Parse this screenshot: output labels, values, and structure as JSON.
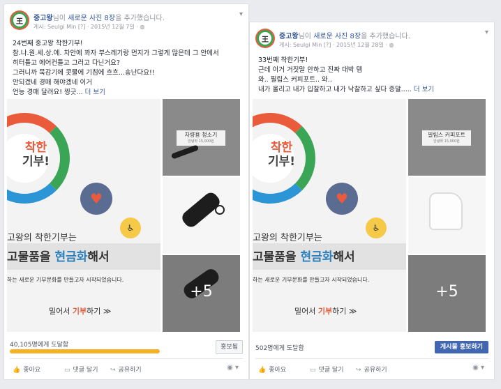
{
  "posts": [
    {
      "author": "중고왕",
      "action_pre": "님이 ",
      "action_link": "새로운 사진 8장",
      "action_post": "을 추가했습니다.",
      "meta": "게시: Seulgi Min [?] · 2015년 12월 7일 · ",
      "body_lines": [
        "24번째 중고왕 착한기부!",
        "참.나.원.세.상.에. 차안에 꽈자 부스레기랑 먼지가 그렇게 많은데 그 안에서",
        "히터틀고 에어컨틀고 그러고 다닌거요?",
        "그러니까 묵감기에 콧물에 기침에 흐흐...숑난다요!!",
        "안되겠네 경매 해야겠네 이거",
        "언능 경매 달려요! 찡긋...  "
      ],
      "more_label": "더 보기",
      "thumb_label": "차량용 청소기",
      "thumb_small": "안녕하 15,000원",
      "plus_count": "+5",
      "reach": "40,105명에게 도달함",
      "reach_fraction": 0.62,
      "promote_label": "홍보됨",
      "actions": {
        "like": "좋아요",
        "comment": "댓글 달기",
        "share": "공유하기"
      }
    },
    {
      "author": "중고왕",
      "action_pre": "님이 ",
      "action_link": "새로운 사진 8장",
      "action_post": "을 추가했습니다.",
      "meta": "게시: Seulgi Min [?] · 2015년 12월 28일 · ",
      "body_lines": [
        "33번째 착한기부!",
        "근데 이거 거짓말 안하고 진짜 대박 템",
        "와.. 필립스 커피포트.. 와..",
        "내가 올리고 내가 입찰하고 내가 낙찰하고 싶다 증말.....  "
      ],
      "more_label": "더 보기",
      "thumb_label": "필립스 커피포트",
      "thumb_small": "안녕하 15,000원",
      "plus_count": "+5",
      "reach": "502명에게 도달함",
      "promote_label": "게시물 홍보하기",
      "actions": {
        "like": "좋아요",
        "comment": "댓글 달기",
        "share": "공유하기"
      }
    }
  ],
  "poster": {
    "logo_line1": "착한",
    "logo_line2": "기부!",
    "caption1": "고왕의 착한기부는",
    "caption2_pre": "고물품을 ",
    "caption2_bold": "현금화",
    "caption2_post": "해서",
    "caption3": "하는 새로운 기부문화를 만들고자 시작되었습니다.",
    "caption4_pre": "밀어서 ",
    "caption4_red": "기부",
    "caption4_post": "하기 ≫"
  },
  "icons": {
    "chevron": "chevron-down-icon",
    "globe": "globe-icon",
    "like": "thumbs-up-icon",
    "comment": "comment-icon",
    "share": "share-icon"
  },
  "colors": {
    "link": "#365899",
    "progress": "#f7b125",
    "button_blue": "#4267b2"
  }
}
